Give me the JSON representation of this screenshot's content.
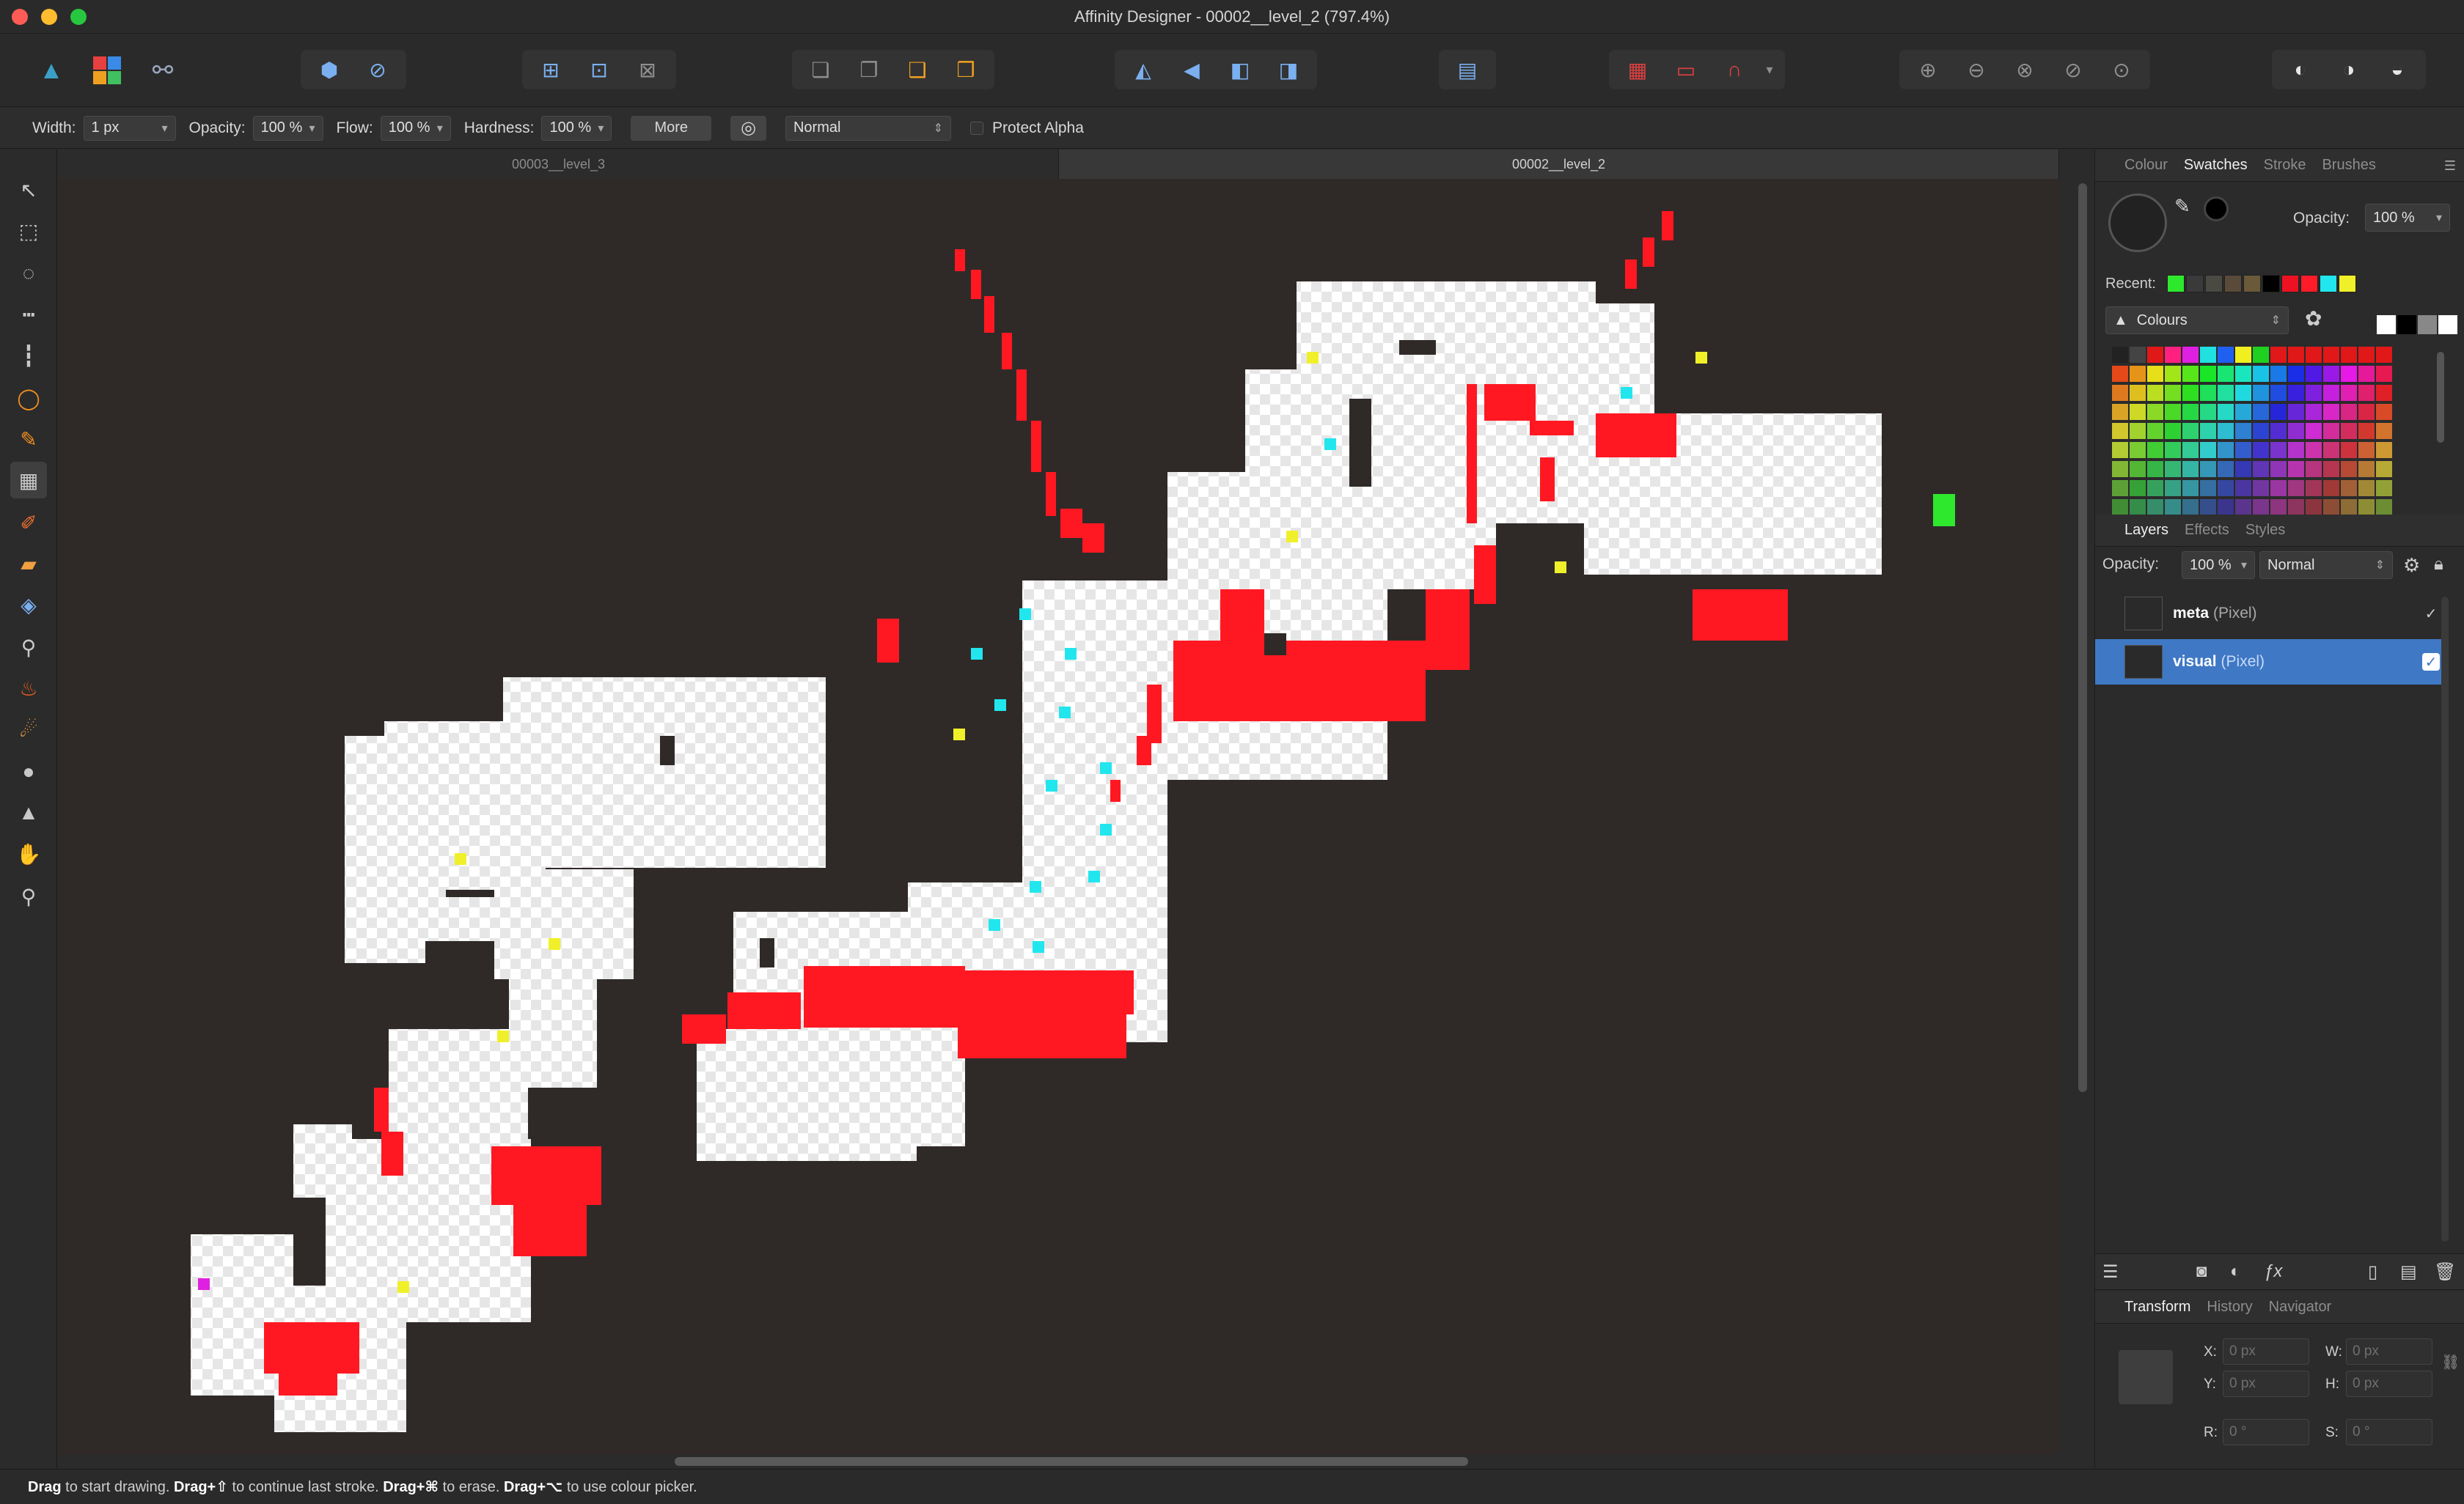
{
  "window": {
    "title": "Affinity Designer - 00002__level_2 (797.4%)"
  },
  "context_bar": {
    "width_label": "Width:",
    "width_value": "1 px",
    "opacity_label": "Opacity:",
    "opacity_value": "100 %",
    "flow_label": "Flow:",
    "flow_value": "100 %",
    "hardness_label": "Hardness:",
    "hardness_value": "100 %",
    "more_label": "More",
    "blend_mode": "Normal",
    "protect_alpha_label": "Protect Alpha"
  },
  "document_tabs": [
    {
      "label": "00003__level_3"
    },
    {
      "label": "00002__level_2"
    }
  ],
  "status_bar": {
    "part1_bold": "Drag",
    "part1": " to start drawing. ",
    "part2_bold": "Drag+⇧",
    "part2": " to continue last stroke. ",
    "part3_bold": "Drag+⌘",
    "part3": " to erase. ",
    "part4_bold": "Drag+⌥",
    "part4": " to use colour picker."
  },
  "colour_panel": {
    "tabs": [
      "Colour",
      "Swatches",
      "Stroke",
      "Brushes"
    ],
    "active_tab": "Swatches",
    "opacity_label": "Opacity:",
    "opacity_value": "100 %",
    "recent_label": "Recent:",
    "recent_colors": [
      "#2ee82e",
      "#3a3a3a",
      "#4a4a42",
      "#5a4a3a",
      "#6a5a3a",
      "#000000",
      "#ee1122",
      "#ff1c2a",
      "#22e6ee",
      "#f0f02a"
    ],
    "palette_name": "Colours"
  },
  "layers_panel": {
    "tabs": [
      "Layers",
      "Effects",
      "Styles"
    ],
    "active_tab": "Layers",
    "opacity_label": "Opacity:",
    "opacity_value": "100 %",
    "blend_mode": "Normal",
    "layers": [
      {
        "name": "meta",
        "type": "(Pixel)",
        "selected": false,
        "visible_mark": "✓"
      },
      {
        "name": "visual",
        "type": "(Pixel)",
        "selected": true,
        "visible_mark": "✓"
      }
    ]
  },
  "transform_panel": {
    "tabs": [
      "Transform",
      "History",
      "Navigator"
    ],
    "active_tab": "Transform",
    "x_label": "X:",
    "x_value": "0 px",
    "y_label": "Y:",
    "y_value": "0 px",
    "w_label": "W:",
    "w_value": "0 px",
    "h_label": "H:",
    "h_value": "0 px",
    "r_label": "R:",
    "r_value": "0 °",
    "s_label": "S:",
    "s_value": "0 °"
  },
  "colors": {
    "accent_selection": "#3f78c5",
    "canvas_bg": "#2f2a28",
    "level_floor": "#ffffff",
    "level_red": "#ff1822",
    "marker_cyan": "#22e6ee",
    "marker_yellow": "#f0f02a",
    "marker_magenta": "#e020e0",
    "marker_green": "#2ee82e"
  }
}
